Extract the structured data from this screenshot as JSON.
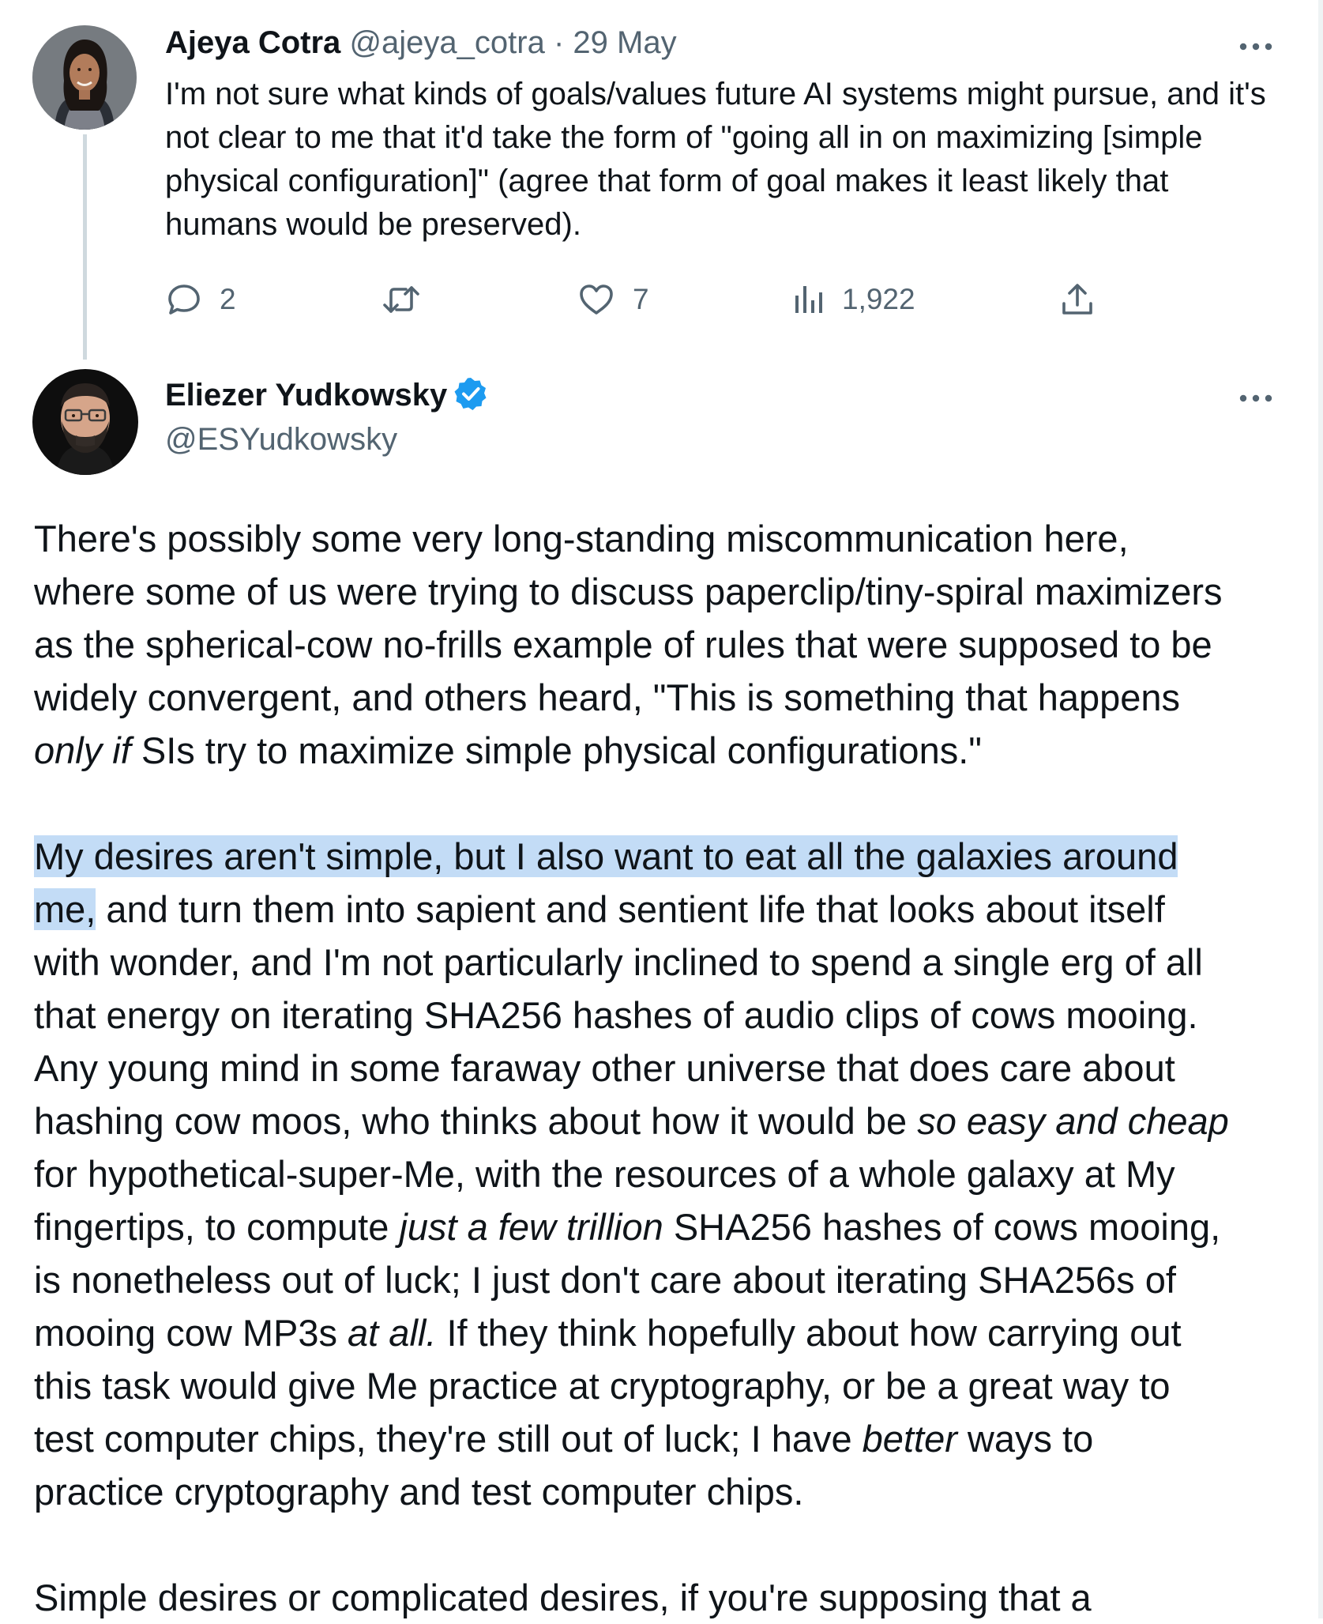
{
  "reply_tweet": {
    "author_name": "Ajeya Cotra",
    "handle": "@ajeya_cotra",
    "separator": "·",
    "date": "29 May",
    "text": "I'm not sure what kinds of goals/values future AI systems might pursue, and it's not clear to me that it'd take the form of \"going all in on maximizing [simple physical configuration]\" (agree that form of goal makes it least likely that humans would be preserved).",
    "actions": {
      "replies": "2",
      "retweets": "",
      "likes": "7",
      "views": "1,922"
    }
  },
  "main_tweet": {
    "author_name": "Eliezer Yudkowsky",
    "handle": "@ESYudkowsky",
    "verified": true,
    "paragraph1": {
      "a": "There's possibly some very long-standing miscommunication here,\nwhere some of us were trying to discuss paperclip/tiny-spiral maximizers\nas the spherical-cow no-frills example of rules that were supposed to be\nwidely convergent, and others heard, \"This is something that happens\n",
      "em": "only if",
      "b": " SIs try to maximize simple physical configurations.\""
    },
    "paragraph2": {
      "highlight": "My desires aren't simple, but I also want to eat all the galaxies around\nme,",
      "a": " and turn them into sapient and sentient life that looks about itself\nwith wonder, and I'm not particularly inclined to spend a single erg of all\nthat energy on iterating SHA256 hashes of audio clips of cows mooing.\nAny young mind in some faraway other universe that does care about\nhashing cow moos, who thinks about how it would be ",
      "em1": "so easy and cheap",
      "b": "\nfor hypothetical-super-Me, with the resources of a whole galaxy at My\nfingertips, to compute ",
      "em2": "just a few trillion",
      "c": " SHA256 hashes of cows mooing,\nis nonetheless out of luck; I just don't care about iterating SHA256s of\nmooing cow MP3s ",
      "em3": "at all.",
      "d": "  If they think hopefully about how carrying out\nthis task would give Me practice at cryptography, or be a great way to\ntest computer chips, they're still out of luck; I have ",
      "em4": "better",
      "e": " ways to\npractice cryptography and test computer chips."
    },
    "paragraph3": {
      "text": "Simple desires or complicated desires, if you're supposing that a"
    }
  },
  "icons": {
    "reply": "reply-bubble-icon",
    "retweet": "retweet-icon",
    "like": "heart-icon",
    "views": "views-bars-icon",
    "share": "share-upload-icon",
    "more": "more-dots-icon",
    "verified": "verified-badge-icon"
  },
  "colors": {
    "text": "#0f1419",
    "muted": "#536471",
    "verified": "#1d9bf0",
    "highlight": "#c3dcf6",
    "thread_line": "#cfd9de"
  }
}
